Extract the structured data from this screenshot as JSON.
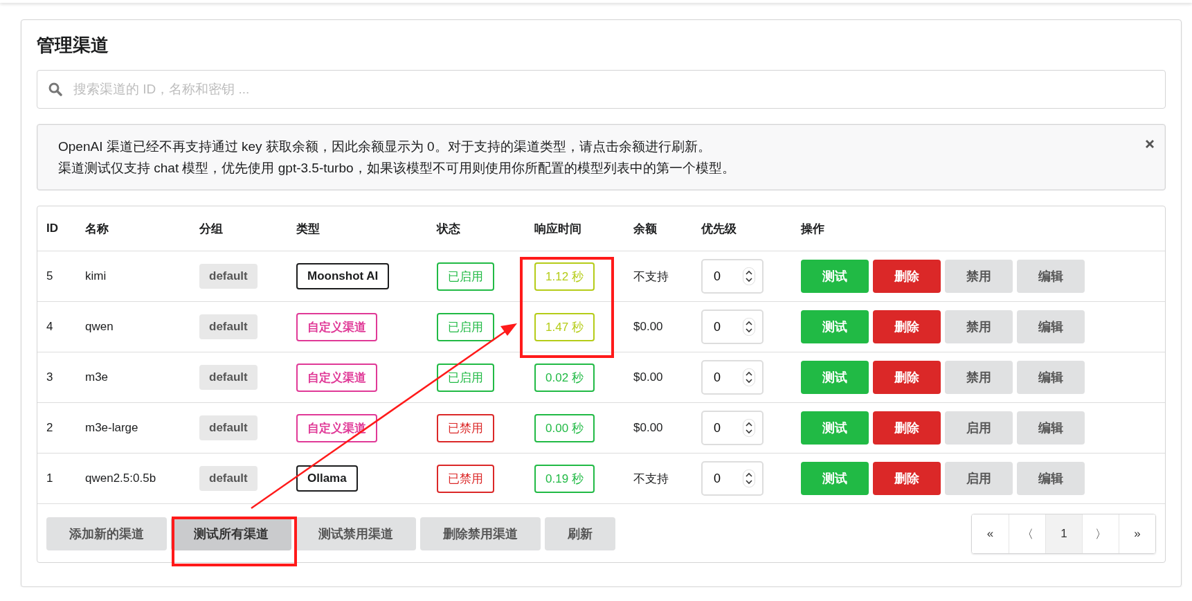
{
  "title": "管理渠道",
  "search": {
    "placeholder": "搜索渠道的 ID，名称和密钥 ..."
  },
  "notice": {
    "lines": [
      "OpenAI 渠道已经不再支持通过 key 获取余额，因此余额显示为 0。对于支持的渠道类型，请点击余额进行刷新。",
      "渠道测试仅支持 chat 模型，优先使用 gpt-3.5-turbo，如果该模型不可用则使用你所配置的模型列表中的第一个模型。"
    ]
  },
  "table": {
    "columns": [
      "ID",
      "名称",
      "分组",
      "类型",
      "状态",
      "响应时间",
      "余额",
      "优先级",
      "操作"
    ],
    "rows": [
      {
        "id": "5",
        "name": "kimi",
        "group": "default",
        "type": {
          "label": "Moonshot AI",
          "color": "#1b1c1d"
        },
        "status": {
          "label": "已启用",
          "enabled": true
        },
        "response": {
          "label": "1.12 秒",
          "color": "#b5cc18"
        },
        "balance": "不支持",
        "priority": "0",
        "actions": [
          {
            "label": "测试",
            "kind": "test"
          },
          {
            "label": "删除",
            "kind": "delete"
          },
          {
            "label": "禁用",
            "kind": "toggle"
          },
          {
            "label": "编辑",
            "kind": "edit"
          }
        ]
      },
      {
        "id": "4",
        "name": "qwen",
        "group": "default",
        "type": {
          "label": "自定义渠道",
          "color": "#e03997"
        },
        "status": {
          "label": "已启用",
          "enabled": true
        },
        "response": {
          "label": "1.47 秒",
          "color": "#b5cc18"
        },
        "balance": "$0.00",
        "priority": "0",
        "actions": [
          {
            "label": "测试",
            "kind": "test"
          },
          {
            "label": "删除",
            "kind": "delete"
          },
          {
            "label": "禁用",
            "kind": "toggle"
          },
          {
            "label": "编辑",
            "kind": "edit"
          }
        ]
      },
      {
        "id": "3",
        "name": "m3e",
        "group": "default",
        "type": {
          "label": "自定义渠道",
          "color": "#e03997"
        },
        "status": {
          "label": "已启用",
          "enabled": true
        },
        "response": {
          "label": "0.02 秒",
          "color": "#21ba45"
        },
        "balance": "$0.00",
        "priority": "0",
        "actions": [
          {
            "label": "测试",
            "kind": "test"
          },
          {
            "label": "删除",
            "kind": "delete"
          },
          {
            "label": "禁用",
            "kind": "toggle"
          },
          {
            "label": "编辑",
            "kind": "edit"
          }
        ]
      },
      {
        "id": "2",
        "name": "m3e-large",
        "group": "default",
        "type": {
          "label": "自定义渠道",
          "color": "#e03997"
        },
        "status": {
          "label": "已禁用",
          "enabled": false
        },
        "response": {
          "label": "0.00 秒",
          "color": "#21ba45"
        },
        "balance": "$0.00",
        "priority": "0",
        "actions": [
          {
            "label": "测试",
            "kind": "test"
          },
          {
            "label": "删除",
            "kind": "delete"
          },
          {
            "label": "启用",
            "kind": "toggle"
          },
          {
            "label": "编辑",
            "kind": "edit"
          }
        ]
      },
      {
        "id": "1",
        "name": "qwen2.5:0.5b",
        "group": "default",
        "type": {
          "label": "Ollama",
          "color": "#1b1c1d"
        },
        "status": {
          "label": "已禁用",
          "enabled": false
        },
        "response": {
          "label": "0.19 秒",
          "color": "#21ba45"
        },
        "balance": "不支持",
        "priority": "0",
        "actions": [
          {
            "label": "测试",
            "kind": "test"
          },
          {
            "label": "删除",
            "kind": "delete"
          },
          {
            "label": "启用",
            "kind": "toggle"
          },
          {
            "label": "编辑",
            "kind": "edit"
          }
        ]
      }
    ]
  },
  "footer_buttons": [
    {
      "label": "添加新的渠道",
      "active": false
    },
    {
      "label": "测试所有渠道",
      "active": true
    },
    {
      "label": "测试禁用渠道",
      "active": false
    },
    {
      "label": "删除禁用渠道",
      "active": false
    },
    {
      "label": "刷新",
      "active": false
    }
  ],
  "pagination": [
    {
      "label": "«",
      "selected": false
    },
    {
      "label": "〈",
      "selected": false
    },
    {
      "label": "1",
      "selected": true
    },
    {
      "label": "〉",
      "selected": false
    },
    {
      "label": "»",
      "selected": false
    }
  ],
  "annotations": [
    {
      "kind": "box"
    },
    {
      "kind": "box"
    },
    {
      "kind": "arrow"
    }
  ]
}
